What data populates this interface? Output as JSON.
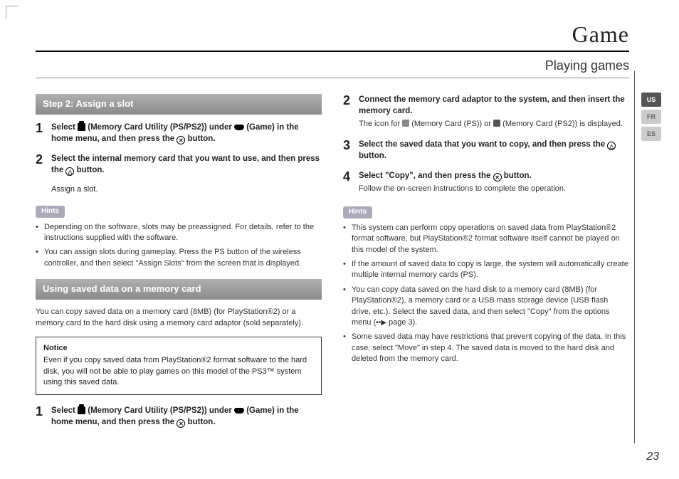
{
  "header": {
    "title": "Game",
    "subtitle": "Playing games"
  },
  "lang": {
    "l0": "US",
    "l1": "FR",
    "l2": "ES"
  },
  "page_number": "23",
  "left": {
    "bar1": "Step 2: Assign a slot",
    "s1_pre": "Select ",
    "s1_mid1": " (Memory Card Utility (PS/PS2)) under ",
    "s1_mid2": " (Game) in the home menu, and then press the ",
    "s1_end": " button.",
    "s2": "Select the internal memory card that you want to use, and then press the ",
    "s2_end": " button.",
    "s2_sub": "Assign a slot.",
    "hints_label": "Hints",
    "h1": "Depending on the software, slots may be preassigned. For details, refer to the instructions supplied with the software.",
    "h2": "You can assign slots during gameplay. Press the PS button of the wireless controller, and then select \"Assign Slots\" from the screen that is displayed.",
    "bar2": "Using saved data on a memory card",
    "para": "You can copy saved data on a memory card (8MB) (for PlayStation®2) or a memory card to the hard disk using a memory card adaptor (sold separately).",
    "notice_t": "Notice",
    "notice_b": "Even if you copy saved data from PlayStation®2 format software to the hard disk, you will not be able to play games on this model of the PS3™ system using this saved data.",
    "b1_pre": "Select ",
    "b1_mid1": " (Memory Card Utility (PS/PS2)) under ",
    "b1_mid2": " (Game) in the home menu, and then press the ",
    "b1_end": " button."
  },
  "right": {
    "s2": "Connect the memory card adaptor to the system, and then insert the memory card.",
    "s2_sub_a": "The icon for ",
    "s2_sub_b": " (Memory Card (PS)) or ",
    "s2_sub_c": " (Memory Card (PS2)) is displayed.",
    "s3_a": "Select the saved data that you want to copy, and then press the ",
    "s3_b": " button.",
    "s4_a": "Select \"Copy\", and then press the ",
    "s4_b": " button.",
    "s4_sub": "Follow the on-screen instructions to complete the operation.",
    "hints_label": "Hints",
    "h1": "This system can perform copy operations on saved data from PlayStation®2 format software, but PlayStation®2 format software itself cannot be played on this model of the system.",
    "h2": "If the amount of saved data to copy is large, the system will automatically create multiple internal memory cards (PS).",
    "h3_a": "You can copy data saved on the hard disk to a memory card (8MB) (for PlayStation®2), a memory card or a USB mass storage device (USB flash drive, etc.). Select the saved data, and then select \"Copy\" from the options menu (",
    "h3_b": " page 3).",
    "h4": "Some saved data may have restrictions that prevent copying of the data. In this case, select \"Move\" in step 4. The saved data is moved to the hard disk and deleted from the memory card."
  }
}
